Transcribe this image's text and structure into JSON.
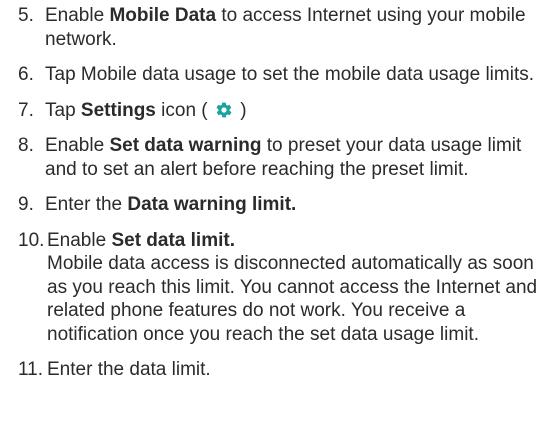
{
  "steps": [
    {
      "num": "5.",
      "pre": "Enable ",
      "bold": "Mobile Data",
      "post": " to access Internet using your mobile network."
    },
    {
      "num": "6.",
      "text": "Tap Mobile data usage to set the mobile data usage limits."
    },
    {
      "num": "7.",
      "pre": "Tap ",
      "bold": "Settings",
      "post": " icon (",
      "post2": ")",
      "icon": "settings-gear-icon",
      "icon_color": "#1aa3a3"
    },
    {
      "num": "8.",
      "pre": "Enable ",
      "bold": "Set data warning",
      "post": " to preset your data usage limit and to set an alert before reaching the preset limit."
    },
    {
      "num": "9.",
      "pre": "Enter the ",
      "bold": "Data warning limit."
    },
    {
      "num": "10.",
      "pre": "Enable ",
      "bold": "Set data limit.",
      "para": "Mobile data access is disconnected automatically as soon as you reach this limit. You cannot access the Internet and related phone features do not work. You receive a notification once you reach the set data usage limit."
    },
    {
      "num": "11.",
      "text": "Enter the data limit."
    }
  ]
}
